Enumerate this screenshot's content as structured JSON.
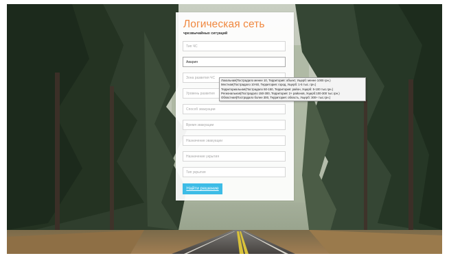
{
  "form": {
    "title": "Логическая сеть",
    "subtitle": "чрезвычайных ситуаций",
    "fields": [
      {
        "name": "type",
        "placeholder": "Тип ЧС",
        "value": ""
      },
      {
        "name": "kind",
        "placeholder": "",
        "value": "Авария"
      },
      {
        "name": "zone",
        "placeholder": "Зона развития ЧС",
        "value": ""
      },
      {
        "name": "damage",
        "placeholder": "Уровень развития",
        "value": ""
      },
      {
        "name": "evac_method",
        "placeholder": "Способ эвакуации",
        "value": ""
      },
      {
        "name": "evac_time",
        "placeholder": "Время эвакуации",
        "value": ""
      },
      {
        "name": "evac_purpose",
        "placeholder": "Назначение эвакуации",
        "value": ""
      },
      {
        "name": "shelter_purpose",
        "placeholder": "Назначение укрытия",
        "value": ""
      },
      {
        "name": "shelter_type",
        "placeholder": "Тип укрытия",
        "value": ""
      }
    ],
    "submit_label": "Найти решение"
  },
  "suggestions": [
    "Локальная(Пострадало менее 10, Территория: объект, Ущерб: менее 1000 грн.)",
    "Местная(Пострадало 10-50, Территория: город, Ущерб: 1-5 тыс. грн.)",
    "Территориальная(Пострадало 50-150, Территория: район, Ущерб: 5-100 тыс.грн.)",
    "Региональная(Пострадало 150-300, Территория: 2+ районов, Ущерб:100-300 тыс.грн.)",
    "Областная(Пострадало более 300, Территория: область, Ущерб: 300+ тыс.грн.)"
  ],
  "colors": {
    "title": "#f0883f",
    "button": "#3dbce6",
    "button_text": "#ffffff"
  }
}
